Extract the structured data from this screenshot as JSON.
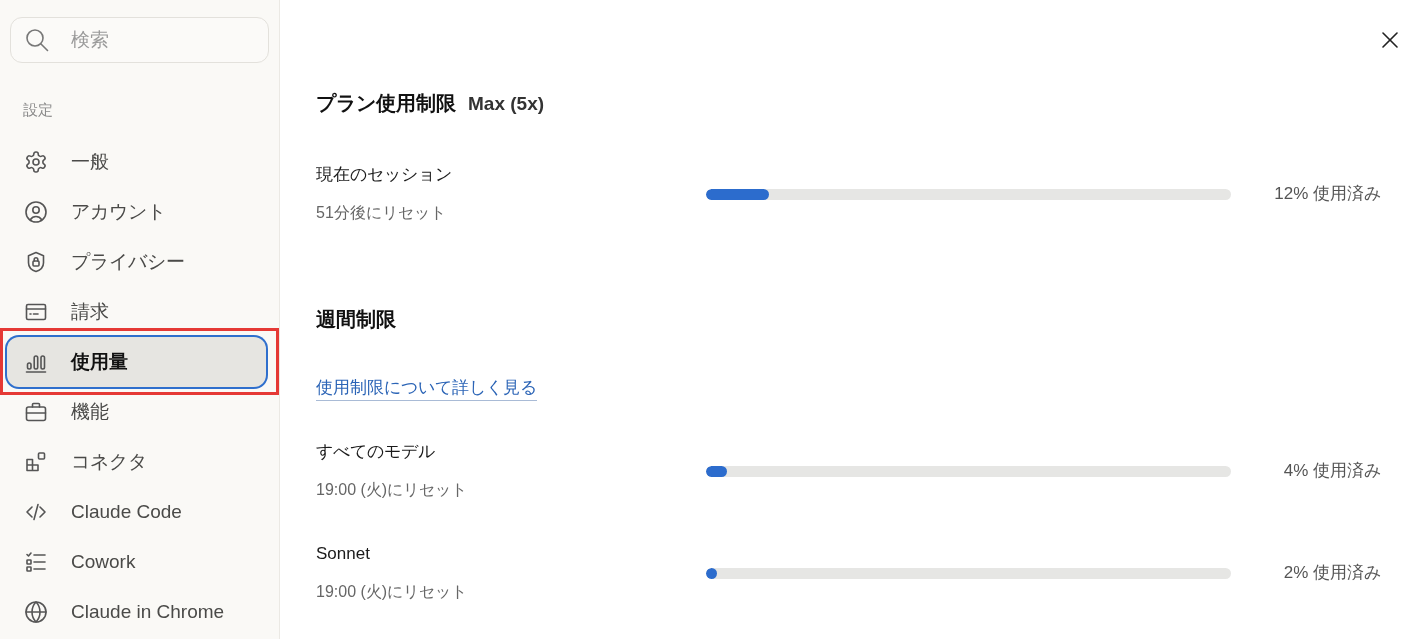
{
  "search": {
    "placeholder": "検索"
  },
  "sidebar": {
    "heading": "設定",
    "items": [
      {
        "label": "一般",
        "selected": false,
        "annotated": false
      },
      {
        "label": "アカウント",
        "selected": false,
        "annotated": false
      },
      {
        "label": "プライバシー",
        "selected": false,
        "annotated": false
      },
      {
        "label": "請求",
        "selected": false,
        "annotated": false
      },
      {
        "label": "使用量",
        "selected": true,
        "annotated": true
      },
      {
        "label": "機能",
        "selected": false,
        "annotated": false
      },
      {
        "label": "コネクタ",
        "selected": false,
        "annotated": false
      },
      {
        "label": "Claude Code",
        "selected": false,
        "annotated": false
      },
      {
        "label": "Cowork",
        "selected": false,
        "annotated": false
      },
      {
        "label": "Claude in Chrome",
        "selected": false,
        "annotated": false
      }
    ]
  },
  "plan_limits": {
    "title": "プラン使用制限",
    "plan": "Max (5x)",
    "meters": [
      {
        "name": "現在のセッション",
        "reset": "51分後にリセット",
        "level": 0.12,
        "reading": "12% 使用済み"
      }
    ]
  },
  "weekly_limits": {
    "title": "週間制限",
    "link": "使用制限について詳しく見る",
    "meters": [
      {
        "name": "すべてのモデル",
        "reset": "19:00 (火)にリセット",
        "level": 0.04,
        "reading": "4% 使用済み"
      },
      {
        "name": "Sonnet",
        "reset": "19:00 (火)にリセット",
        "level": 0.02,
        "reading": "2% 使用済み"
      }
    ]
  }
}
